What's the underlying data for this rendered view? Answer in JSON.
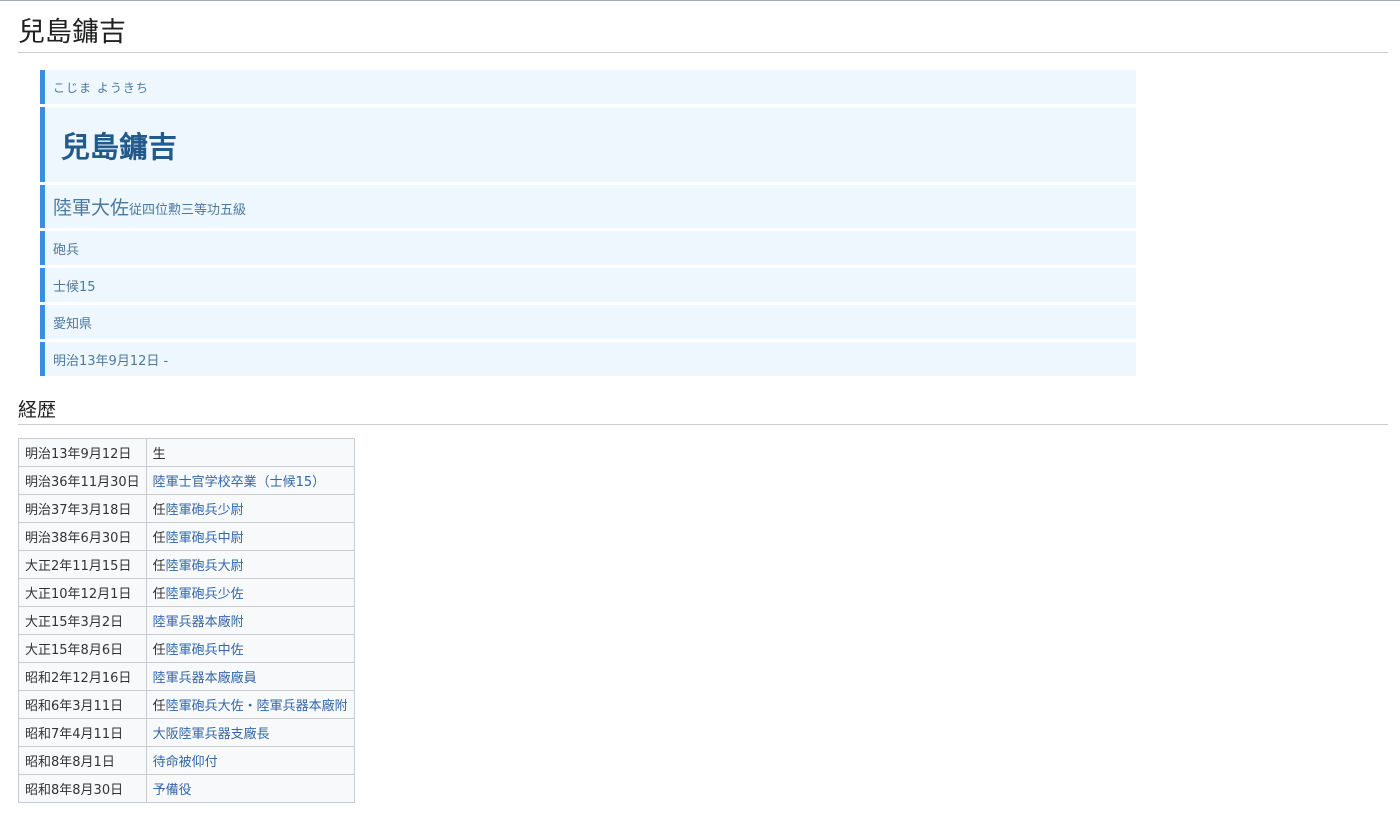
{
  "page": {
    "title": "兒島鏞吉"
  },
  "profile": {
    "reading": "こじま ようきち",
    "name": "兒島鏞吉",
    "rank_main": "陸軍大佐",
    "rank_sub": "従四位勲三等功五級",
    "branch": "砲兵",
    "class": "士候15",
    "origin": "愛知県",
    "lifespan": "明治13年9月12日 -"
  },
  "career": {
    "heading": "経歴",
    "rows": [
      {
        "date": "明治13年9月12日",
        "prefix": "",
        "event": "生"
      },
      {
        "date": "明治36年11月30日",
        "prefix": "",
        "event": "陸軍士官学校卒業（士候15）"
      },
      {
        "date": "明治37年3月18日",
        "prefix": "任",
        "event": "陸軍砲兵少尉"
      },
      {
        "date": "明治38年6月30日",
        "prefix": "任",
        "event": "陸軍砲兵中尉"
      },
      {
        "date": "大正2年11月15日",
        "prefix": "任",
        "event": "陸軍砲兵大尉"
      },
      {
        "date": "大正10年12月1日",
        "prefix": "任",
        "event": "陸軍砲兵少佐"
      },
      {
        "date": "大正15年3月2日",
        "prefix": "",
        "event": "陸軍兵器本廠附"
      },
      {
        "date": "大正15年8月6日",
        "prefix": "任",
        "event": "陸軍砲兵中佐"
      },
      {
        "date": "昭和2年12月16日",
        "prefix": "",
        "event": "陸軍兵器本廠廠員"
      },
      {
        "date": "昭和6年3月11日",
        "prefix": "任",
        "event": "陸軍砲兵大佐・陸軍兵器本廠附"
      },
      {
        "date": "昭和7年4月11日",
        "prefix": "",
        "event": "大阪陸軍兵器支廠長"
      },
      {
        "date": "昭和8年8月1日",
        "prefix": "",
        "event": "待命被仰付"
      },
      {
        "date": "昭和8年8月30日",
        "prefix": "",
        "event": "予備役"
      }
    ]
  }
}
